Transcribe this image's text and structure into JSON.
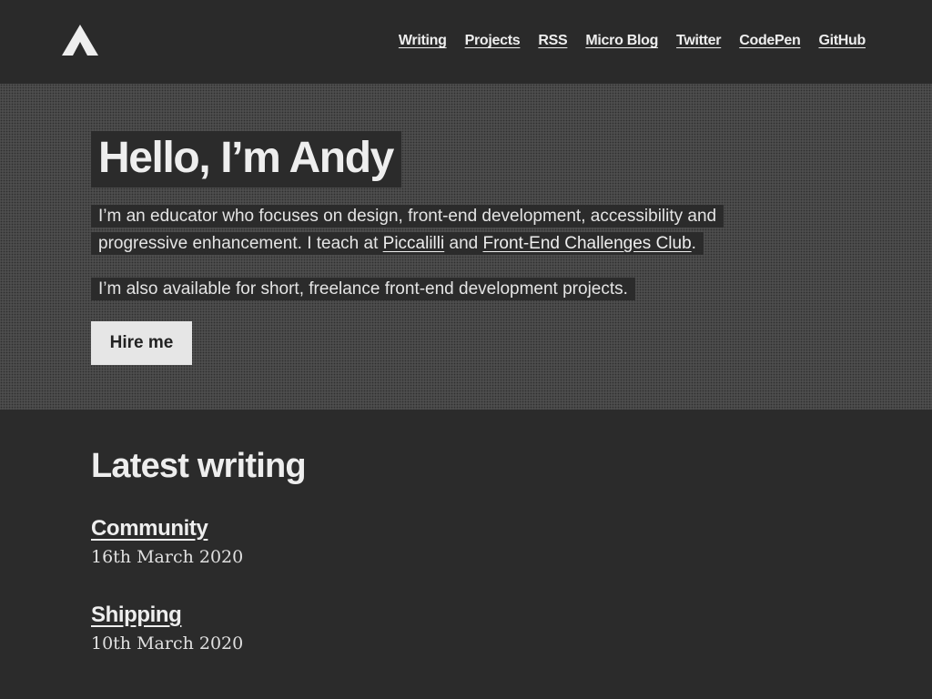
{
  "header": {
    "logo_icon": "triangle-logo-icon",
    "nav": [
      {
        "label": "Writing"
      },
      {
        "label": "Projects"
      },
      {
        "label": "RSS"
      },
      {
        "label": "Micro Blog"
      },
      {
        "label": "Twitter"
      },
      {
        "label": "CodePen"
      },
      {
        "label": "GitHub"
      }
    ]
  },
  "intro": {
    "title": "Hello, I’m Andy",
    "p1_before": "I’m an educator who focuses on design, front-end development, accessibility and progressive enhancement. I teach at ",
    "p1_link1": "Piccalilli",
    "p1_mid": " and ",
    "p1_link2": "Front-End Challenges Club",
    "p1_after": ".",
    "p2": "I’m also available for short, freelance front-end development projects.",
    "button_label": "Hire me"
  },
  "writing": {
    "title": "Latest writing",
    "posts": [
      {
        "title": "Community",
        "date": "16th March 2020"
      },
      {
        "title": "Shipping",
        "date": "10th March 2020"
      }
    ]
  },
  "colors": {
    "background": "#2b2b2b",
    "intro_background": "#484848",
    "text": "#eeeeee",
    "button_bg": "#e6e6e6"
  }
}
